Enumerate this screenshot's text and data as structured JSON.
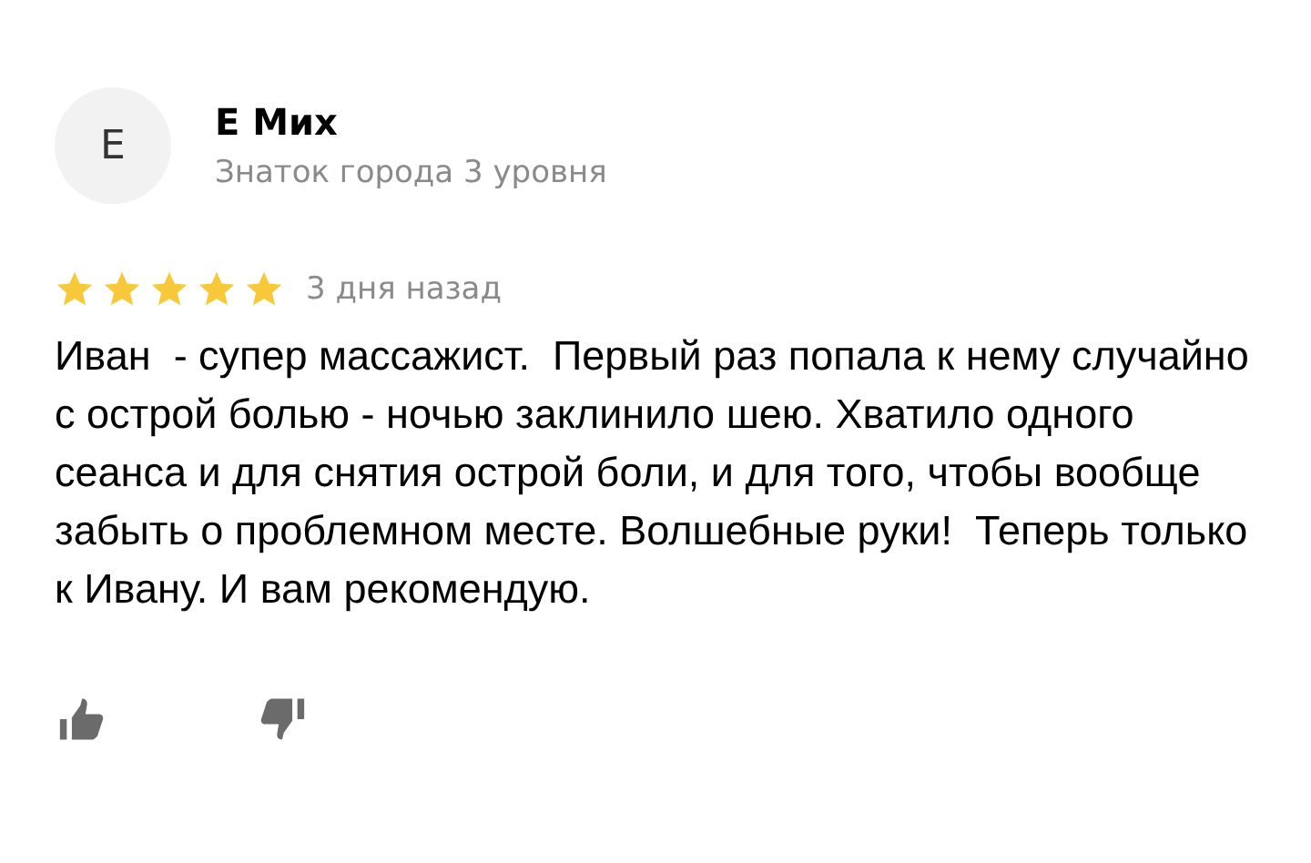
{
  "author": {
    "initial": "Е",
    "name": "Е Мих",
    "status": "Знаток города 3 уровня"
  },
  "review": {
    "stars": 5,
    "date": "3 дня назад",
    "text": "Иван  - супер массажист.  Первый раз попала к нему случайно с острой болью - ночью заклинило шею. Хватило одного сеанса и для снятия острой боли, и для того, чтобы вообще забыть о проблемном месте. Волшебные руки!  Теперь только к Ивану. И вам рекомендую."
  }
}
